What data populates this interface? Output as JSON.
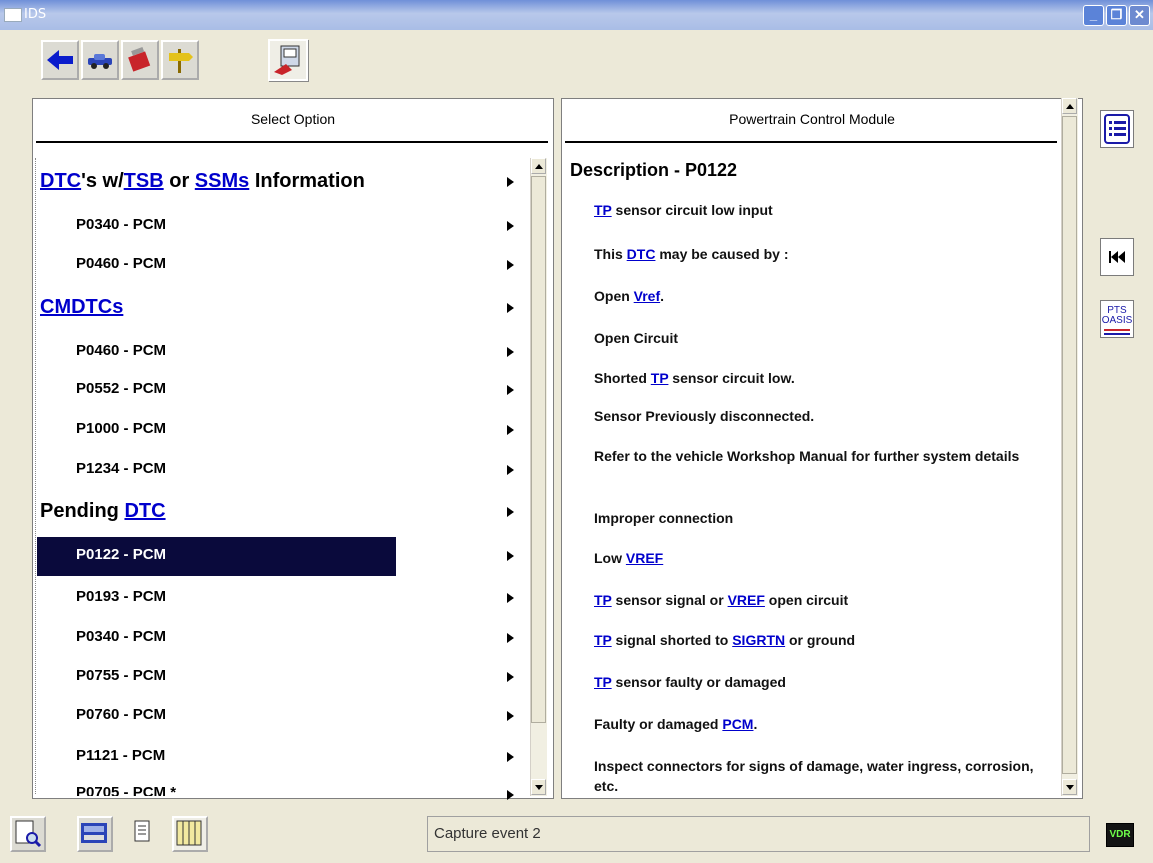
{
  "window": {
    "title": "IDS"
  },
  "toolbar": {
    "active_icon": "vdr-icon"
  },
  "left_panel": {
    "header": "Select Option",
    "rows": [
      {
        "kind": "group",
        "parts": [
          {
            "text": "DTC",
            "link": true
          },
          {
            "text": "'s w/",
            "link": false
          },
          {
            "text": "TSB",
            "link": true
          },
          {
            "text": " or ",
            "link": false
          },
          {
            "text": "SSMs",
            "link": true
          },
          {
            "text": " Information",
            "link": false
          }
        ]
      },
      {
        "kind": "item",
        "label": "P0340 - PCM"
      },
      {
        "kind": "item",
        "label": "P0460 - PCM"
      },
      {
        "kind": "group",
        "parts": [
          {
            "text": "CMDTCs",
            "link": true
          }
        ]
      },
      {
        "kind": "item",
        "label": "P0460 - PCM"
      },
      {
        "kind": "item",
        "label": "P0552 - PCM"
      },
      {
        "kind": "item",
        "label": "P1000 - PCM"
      },
      {
        "kind": "item",
        "label": "P1234 - PCM"
      },
      {
        "kind": "group",
        "parts": [
          {
            "text": "Pending ",
            "link": false
          },
          {
            "text": "DTC",
            "link": true
          }
        ]
      },
      {
        "kind": "item",
        "label": "P0122 - PCM",
        "selected": true
      },
      {
        "kind": "item",
        "label": "P0193 - PCM"
      },
      {
        "kind": "item",
        "label": "P0340 - PCM"
      },
      {
        "kind": "item",
        "label": "P0755 - PCM"
      },
      {
        "kind": "item",
        "label": "P0760 - PCM"
      },
      {
        "kind": "item",
        "label": "P1121 - PCM"
      },
      {
        "kind": "item",
        "label": "P0705 - PCM *"
      }
    ]
  },
  "right_panel": {
    "header": "Powertrain Control Module",
    "title": "Description - P0122",
    "lines": [
      [
        {
          "text": "TP",
          "link": true
        },
        {
          "text": " sensor circuit low input",
          "link": false
        }
      ],
      [
        {
          "text": "This ",
          "link": false
        },
        {
          "text": "DTC",
          "link": true
        },
        {
          "text": " may be caused by :",
          "link": false
        }
      ],
      [
        {
          "text": "Open ",
          "link": false
        },
        {
          "text": "Vref",
          "link": true
        },
        {
          "text": ".",
          "link": false
        }
      ],
      [
        {
          "text": "Open Circuit",
          "link": false
        }
      ],
      [
        {
          "text": "Shorted ",
          "link": false
        },
        {
          "text": "TP",
          "link": true
        },
        {
          "text": " sensor circuit low.",
          "link": false
        }
      ],
      [
        {
          "text": "Sensor Previously disconnected.",
          "link": false
        }
      ],
      [
        {
          "text": "Refer to the vehicle Workshop Manual for further system details",
          "link": false
        }
      ],
      [
        {
          "text": "Improper connection",
          "link": false
        }
      ],
      [
        {
          "text": "Low ",
          "link": false
        },
        {
          "text": "VREF",
          "link": true
        }
      ],
      [
        {
          "text": "TP",
          "link": true
        },
        {
          "text": " sensor signal or ",
          "link": false
        },
        {
          "text": "VREF",
          "link": true
        },
        {
          "text": " open circuit",
          "link": false
        }
      ],
      [
        {
          "text": "TP",
          "link": true
        },
        {
          "text": " signal shorted to ",
          "link": false
        },
        {
          "text": "SIGRTN",
          "link": true
        },
        {
          "text": " or ground",
          "link": false
        }
      ],
      [
        {
          "text": "TP",
          "link": true
        },
        {
          "text": " sensor faulty or damaged",
          "link": false
        }
      ],
      [
        {
          "text": "Faulty or damaged ",
          "link": false
        },
        {
          "text": "PCM",
          "link": true
        },
        {
          "text": ".",
          "link": false
        }
      ],
      [
        {
          "text": "Inspect connectors for signs of damage, water ingress, corrosion, etc.",
          "link": false
        }
      ]
    ]
  },
  "side_buttons": {
    "list": "list-icon",
    "back": "skip-back-icon",
    "pts_oasis": "PTS\nOASIS"
  },
  "status": {
    "capture_text": "Capture event 2",
    "vdr_label": "VDR"
  }
}
